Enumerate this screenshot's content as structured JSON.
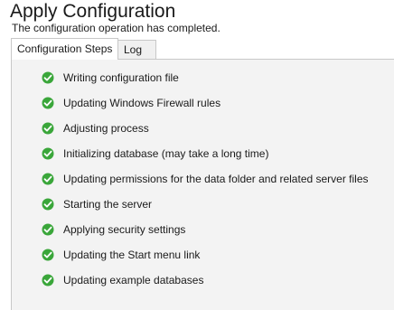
{
  "header": {
    "title": "Apply Configuration",
    "subtitle": "The configuration operation has completed."
  },
  "tabs": [
    {
      "label": "Configuration Steps",
      "active": true
    },
    {
      "label": "Log",
      "active": false
    }
  ],
  "steps": [
    {
      "label": "Writing configuration file",
      "status": "done",
      "icon": "check-circle-icon"
    },
    {
      "label": "Updating Windows Firewall rules",
      "status": "done",
      "icon": "check-circle-icon"
    },
    {
      "label": "Adjusting process",
      "status": "done",
      "icon": "check-circle-icon"
    },
    {
      "label": "Initializing database (may take a long time)",
      "status": "done",
      "icon": "check-circle-icon"
    },
    {
      "label": "Updating permissions for the data folder and related server files",
      "status": "done",
      "icon": "check-circle-icon"
    },
    {
      "label": "Starting the server",
      "status": "done",
      "icon": "check-circle-icon"
    },
    {
      "label": "Applying security settings",
      "status": "done",
      "icon": "check-circle-icon"
    },
    {
      "label": "Updating the Start menu link",
      "status": "done",
      "icon": "check-circle-icon"
    },
    {
      "label": "Updating example databases",
      "status": "done",
      "icon": "check-circle-icon"
    }
  ],
  "colors": {
    "check": "#3aa63a",
    "panel": "#f3f3f3"
  }
}
